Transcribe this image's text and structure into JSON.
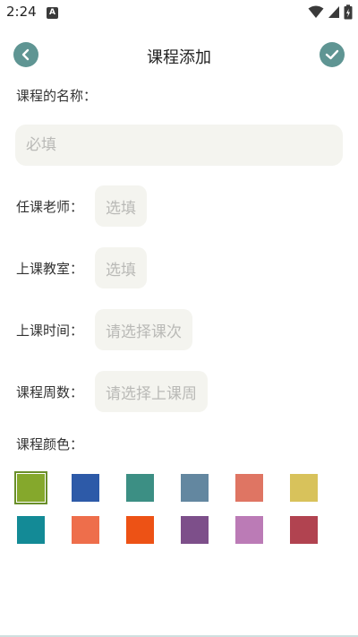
{
  "status": {
    "time": "2:24",
    "notification_icon": "a-icon"
  },
  "header": {
    "title": "课程添加",
    "back_icon": "chevron-left-icon",
    "confirm_icon": "check-icon",
    "accent": "#5f9593"
  },
  "name_field": {
    "label": "课程的名称：",
    "placeholder": "必填",
    "value": ""
  },
  "fields": [
    {
      "label": "任课老师：",
      "placeholder": "选填"
    },
    {
      "label": "上课教室：",
      "placeholder": "选填"
    },
    {
      "label": "上课时间：",
      "placeholder": "请选择课次"
    },
    {
      "label": "课程周数：",
      "placeholder": "请选择上课周"
    }
  ],
  "color_section": {
    "label": "课程颜色：",
    "selected_index": 0,
    "colors": [
      "#85a82c",
      "#2d5aa8",
      "#3c8f84",
      "#6387a0",
      "#df7563",
      "#d8c25b",
      "#138a96",
      "#ee6e4b",
      "#ed5215",
      "#7d4f8a",
      "#bb7bb6",
      "#b14350"
    ]
  }
}
